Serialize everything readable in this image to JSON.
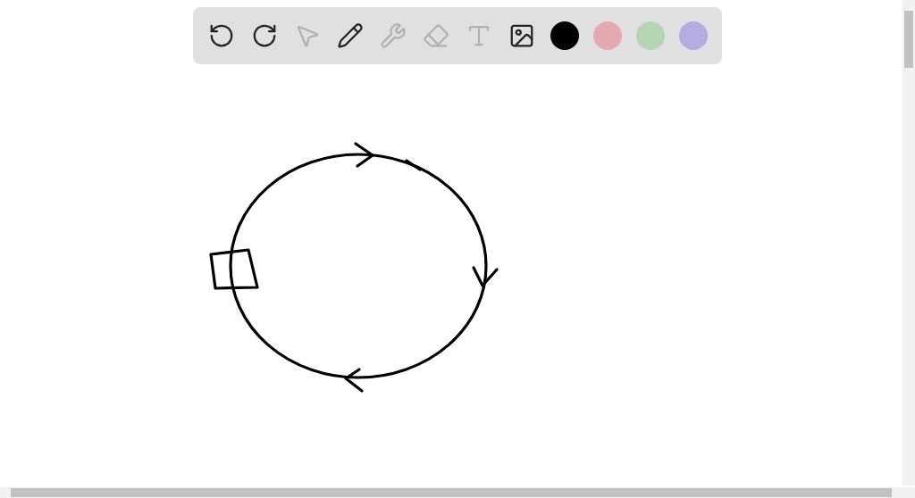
{
  "toolbar": {
    "tools": [
      {
        "kind": "undo",
        "disabled": false
      },
      {
        "kind": "redo",
        "disabled": false
      },
      {
        "kind": "select",
        "disabled": true
      },
      {
        "kind": "pen",
        "disabled": false
      },
      {
        "kind": "tools",
        "disabled": true
      },
      {
        "kind": "eraser",
        "disabled": true
      },
      {
        "kind": "text",
        "disabled": true
      },
      {
        "kind": "image",
        "disabled": false
      }
    ],
    "colors": [
      {
        "color": "#000000"
      },
      {
        "color": "#e3a9b0"
      },
      {
        "color": "#b5d6b5"
      },
      {
        "color": "#b3ade4"
      }
    ]
  }
}
